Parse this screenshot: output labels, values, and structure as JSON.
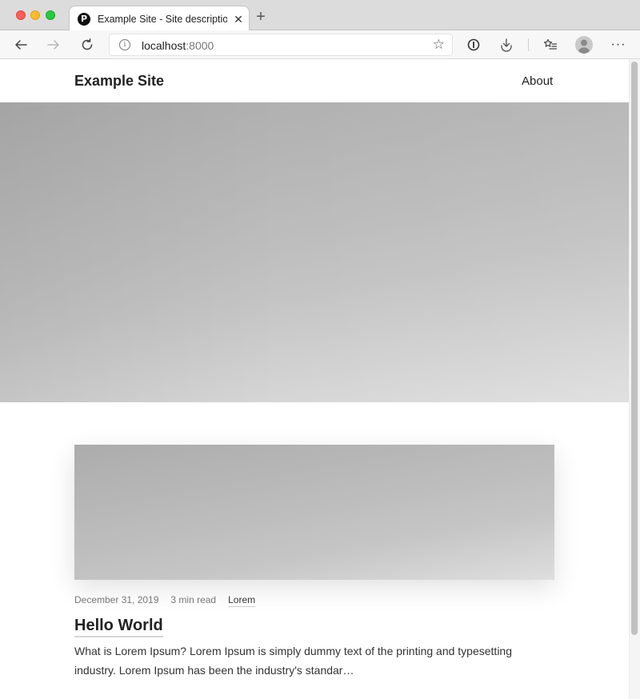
{
  "browser": {
    "tab": {
      "favicon_letter": "P",
      "title": "Example Site - Site description"
    },
    "address_bar": {
      "host": "localhost",
      "port": ":8000"
    },
    "icons": {
      "back": "back-arrow-icon",
      "forward": "forward-arrow-icon",
      "refresh": "refresh-icon",
      "info": "info-icon",
      "favorite": "star-icon",
      "reader": "reader-mode-icon",
      "downloads": "downloads-icon",
      "favorites": "favorites-list-icon",
      "profile": "profile-avatar-icon",
      "more": "more-menu-icon"
    }
  },
  "site": {
    "title": "Example Site",
    "nav": [
      {
        "label": "About"
      }
    ]
  },
  "post": {
    "date": "December 31, 2019",
    "read_time": "3 min read",
    "tag": "Lorem",
    "title": "Hello World",
    "excerpt": "What is Lorem Ipsum? Lorem Ipsum is simply dummy text of the printing and typesetting industry. Lorem Ipsum has been the industry's standar…"
  },
  "colors": {
    "close": "#ff5f57",
    "minimize": "#febc2e",
    "maximize": "#28c840"
  }
}
